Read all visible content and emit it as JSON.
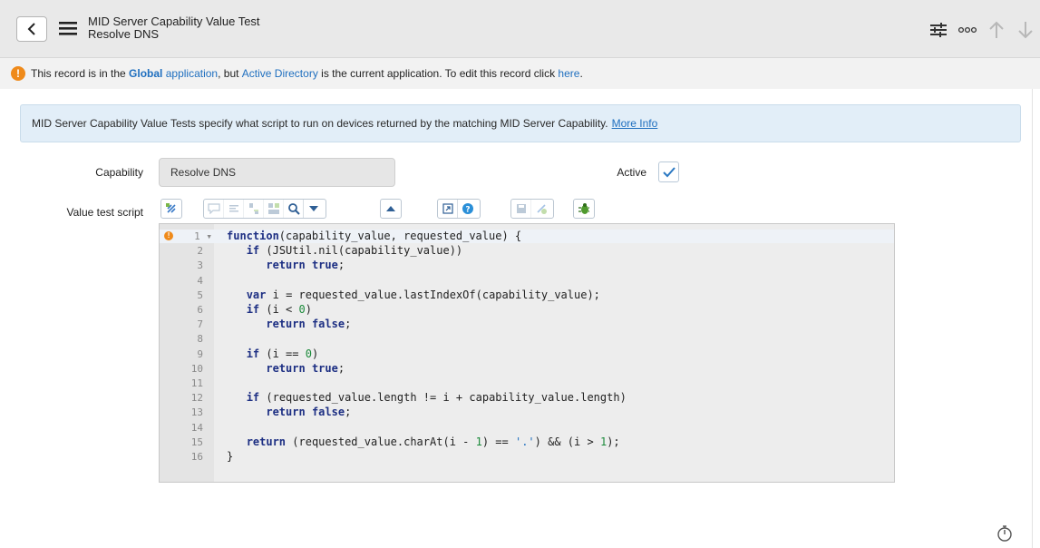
{
  "header": {
    "title": "MID Server Capability Value Test",
    "subtitle": "Resolve DNS",
    "icons": [
      "back-icon",
      "hamburger-icon",
      "sliders-icon",
      "more-icon",
      "arrow-up-icon",
      "arrow-down-icon"
    ]
  },
  "notice": {
    "part1": "This record is in the ",
    "app_link": "Global",
    "part2": " application",
    "part3": ", but ",
    "current_app": "Active Directory",
    "part4": " is the current application. To edit this record click ",
    "here_link": "here",
    "part5": "."
  },
  "info": {
    "text": "MID Server Capability Value Tests specify what script to run on devices returned by the matching MID Server Capability.",
    "link": "More Info"
  },
  "form": {
    "capability_label": "Capability",
    "capability_value": "Resolve DNS",
    "active_label": "Active",
    "active_checked": true,
    "script_label": "Value test script"
  },
  "editor": {
    "line_numbers": [
      "1",
      "2",
      "3",
      "4",
      "5",
      "6",
      "7",
      "8",
      "9",
      "10",
      "11",
      "12",
      "13",
      "14",
      "15",
      "16"
    ],
    "lines": [
      "function(capability_value, requested_value) {",
      "   if (JSUtil.nil(capability_value))",
      "      return true;",
      "",
      "   var i = requested_value.lastIndexOf(capability_value);",
      "   if (i < 0)",
      "      return false;",
      "",
      "   if (i == 0)",
      "      return true;",
      "",
      "   if (requested_value.length != i + capability_value.length)",
      "      return false;",
      "",
      "   return (requested_value.charAt(i - 1) == '.') && (i > 1);",
      "}"
    ]
  },
  "colors": {
    "accent_blue": "#1f6fbf",
    "warning_orange": "#ef8a1a",
    "info_bg": "#e2eef8",
    "header_bg": "#e9e9e9"
  }
}
